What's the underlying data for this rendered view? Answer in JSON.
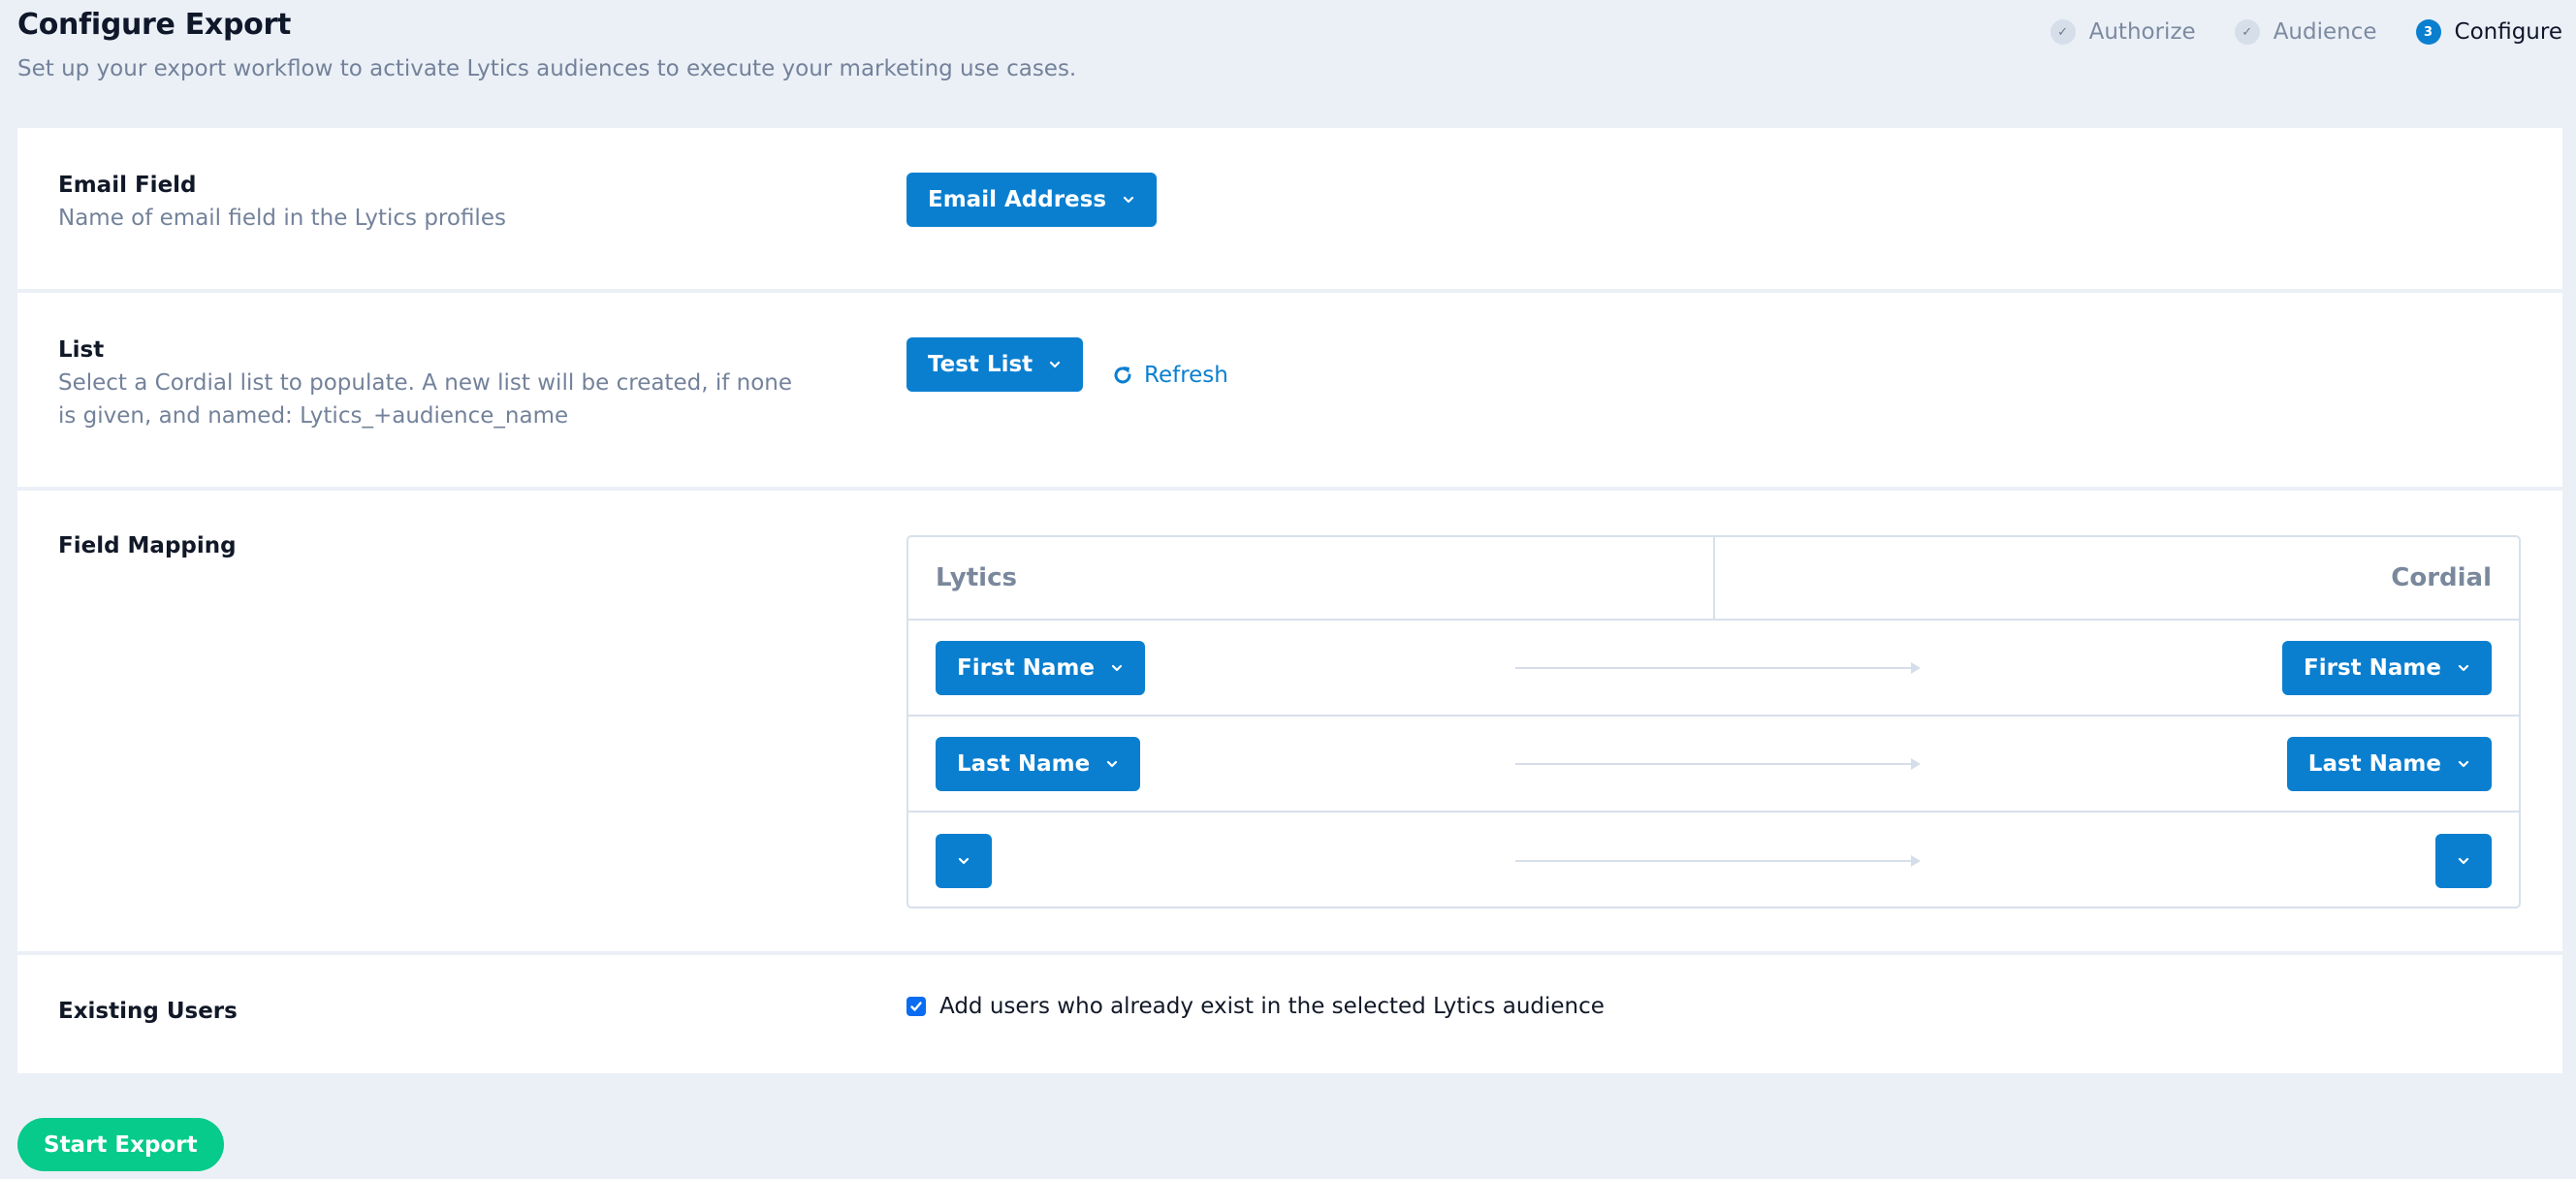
{
  "header": {
    "title": "Configure Export",
    "subtitle": "Set up your export workflow to activate Lytics audiences to execute your marketing use cases."
  },
  "steps": [
    {
      "label": "Authorize",
      "status": "complete",
      "marker": "✓"
    },
    {
      "label": "Audience",
      "status": "complete",
      "marker": "✓"
    },
    {
      "label": "Configure",
      "status": "active",
      "marker": "3"
    }
  ],
  "email_field": {
    "label": "Email Field",
    "description": "Name of email field in the Lytics profiles",
    "selected": "Email Address"
  },
  "list": {
    "label": "List",
    "description": "Select a Cordial list to populate. A new list will be created, if none is given, and named: Lytics_+audience_name",
    "selected": "Test List",
    "refresh_label": "Refresh"
  },
  "field_mapping": {
    "label": "Field Mapping",
    "source_header": "Lytics",
    "target_header": "Cordial",
    "rows": [
      {
        "source": "First Name",
        "target": "First Name"
      },
      {
        "source": "Last Name",
        "target": "Last Name"
      },
      {
        "source": "",
        "target": ""
      }
    ]
  },
  "existing_users": {
    "label": "Existing Users",
    "checkbox_label": "Add users who already exist in the selected Lytics audience",
    "checked": true
  },
  "actions": {
    "start_export": "Start Export"
  },
  "colors": {
    "primary": "#0a7fd0",
    "success": "#06cb8a",
    "background": "#ebf0f7",
    "muted_text": "#73829a"
  }
}
